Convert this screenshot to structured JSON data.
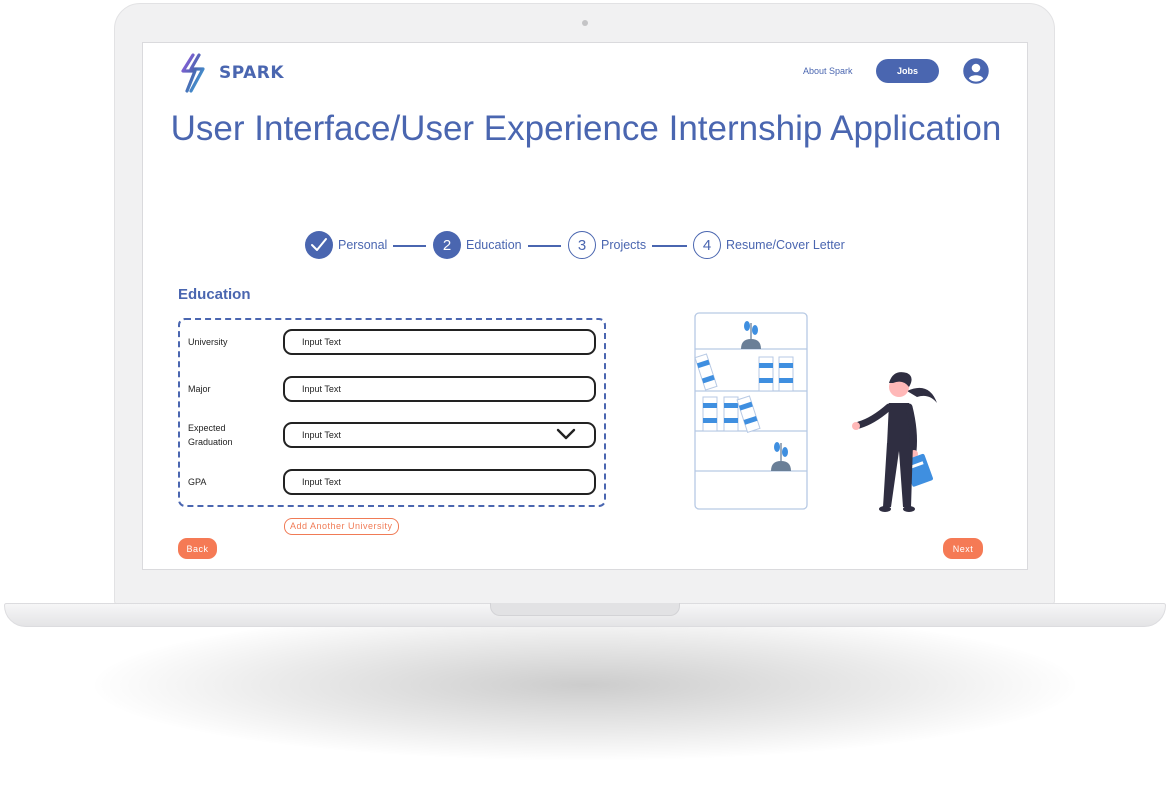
{
  "header": {
    "brand": "SPARK",
    "nav_about": "About Spark",
    "nav_jobs": "Jobs"
  },
  "page": {
    "title": "User Interface/User Experience Internship Application"
  },
  "stepper": {
    "steps": [
      {
        "number": "1",
        "label": "Personal",
        "state": "complete"
      },
      {
        "number": "2",
        "label": "Education",
        "state": "active"
      },
      {
        "number": "3",
        "label": "Projects",
        "state": "upcoming"
      },
      {
        "number": "4",
        "label": "Resume/Cover Letter",
        "state": "upcoming"
      }
    ]
  },
  "form": {
    "section_title": "Education",
    "fields": [
      {
        "label": "University",
        "value": "Input Text",
        "type": "text"
      },
      {
        "label": "Major",
        "value": "Input Text",
        "type": "text"
      },
      {
        "label": "Expected\nGraduation",
        "value": "Input Text",
        "type": "select"
      },
      {
        "label": "GPA",
        "value": "Input Text",
        "type": "text"
      }
    ],
    "add_another": "Add Another University"
  },
  "actions": {
    "back": "Back",
    "next": "Next"
  },
  "colors": {
    "primary": "#4a66b0",
    "accent": "#f57a55",
    "illustration_blue": "#3f8fe0"
  },
  "icons": {
    "logo": "lightning-bolt-icon",
    "user": "user-account-icon",
    "check": "checkmark-icon",
    "dropdown": "chevron-down-icon"
  }
}
